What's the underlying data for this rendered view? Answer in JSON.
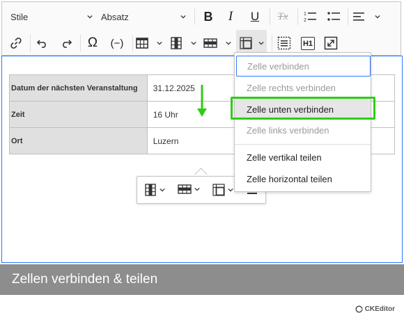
{
  "toolbar": {
    "style_dropdown": "Stile",
    "heading_dropdown": "Absatz",
    "buttons": {
      "bold": "B",
      "italic": "I",
      "underline": "U",
      "clear_format": "Tx",
      "heading1": "H1",
      "special_char": "Ω",
      "placeholder": "(−)"
    }
  },
  "table": {
    "rows": [
      {
        "label": "Datum der nächsten Veranstaltung",
        "value": "31.12.2025"
      },
      {
        "label": "Zeit",
        "value": "16 Uhr"
      },
      {
        "label": "Ort",
        "value": "Luzern"
      }
    ]
  },
  "dropdown": {
    "items": [
      {
        "label": "Zelle verbinden",
        "enabled": false
      },
      {
        "label": "Zelle rechts verbinden",
        "enabled": false
      },
      {
        "label": "Zelle unten verbinden",
        "enabled": true
      },
      {
        "label": "Zelle links verbinden",
        "enabled": false
      },
      {
        "label": "Zelle vertikal teilen",
        "enabled": true
      },
      {
        "label": "Zelle horizontal teilen",
        "enabled": true
      }
    ]
  },
  "brand": {
    "logo_text": "CKEditor"
  },
  "caption": {
    "text": "Zellen verbinden & teilen"
  },
  "colors": {
    "accent_blue": "#2977ff",
    "highlight_green": "#2fcc16",
    "caption_bg": "#8d8d8d",
    "header_cell_bg": "#e0e0e0"
  },
  "icons": [
    "chevron-down-icon",
    "bold-icon",
    "italic-icon",
    "underline-icon",
    "remove-format-icon",
    "numbered-list-icon",
    "bulleted-list-icon",
    "align-left-icon",
    "link-icon",
    "undo-icon",
    "redo-icon",
    "special-characters-icon",
    "placeholder-icon",
    "insert-table-icon",
    "table-column-icon",
    "table-row-icon",
    "merge-cells-icon",
    "page-break-icon",
    "heading1-icon",
    "fullscreen-icon",
    "ckeditor-logo-icon"
  ]
}
